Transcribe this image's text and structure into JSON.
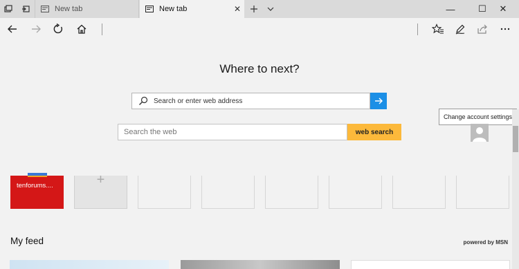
{
  "tabs": {
    "inactive": {
      "title": "New tab"
    },
    "active": {
      "title": "New tab"
    }
  },
  "window_controls": {
    "minimize": "—",
    "maximize": "☐",
    "close": "✕"
  },
  "toolbar": {
    "icons": [
      "back-arrow-icon",
      "forward-arrow-icon",
      "refresh-icon",
      "home-icon",
      "favorites-star-icon",
      "pen-icon",
      "share-icon",
      "more-icon"
    ]
  },
  "new_tab_page": {
    "heading": "Where to next?",
    "address_placeholder": "Search or enter web address",
    "web_search_placeholder": "Search the web",
    "web_search_button": "web search",
    "account_tooltip": "Change account settings",
    "tiles": [
      {
        "label": "tenforums...."
      },
      {
        "label": "+"
      }
    ],
    "feed_title": "My feed",
    "powered_by": "powered by MSN"
  },
  "colors": {
    "accent_blue": "#1b8fe6",
    "search_button": "#fcb93b",
    "tile_red": "#d41717"
  }
}
